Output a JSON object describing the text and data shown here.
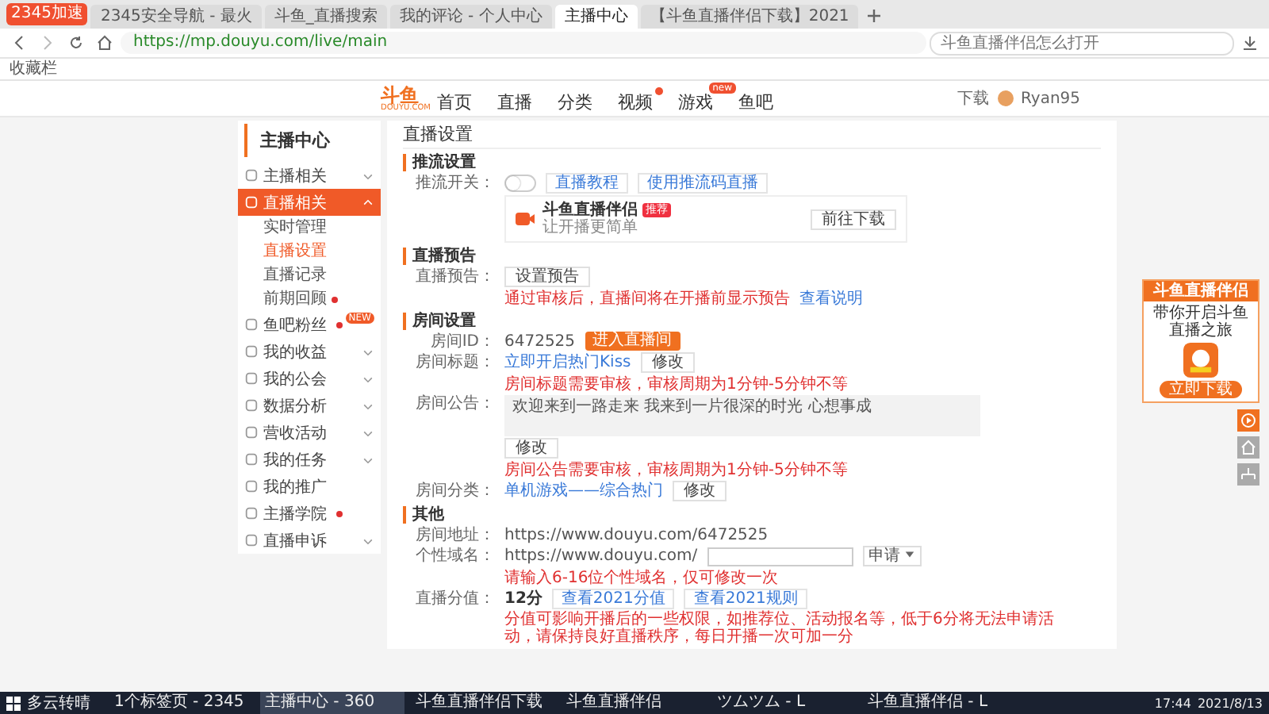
{
  "browser": {
    "badge": "2345加速",
    "tabs": [
      {
        "title": "2345安全导航 - 最火",
        "selected": false
      },
      {
        "title": "斗鱼_直播搜索",
        "selected": false
      },
      {
        "title": "我的评论 - 个人中心",
        "selected": false
      },
      {
        "title": "主播中心",
        "selected": true
      },
      {
        "title": "【斗鱼直播伴侣下载】2021",
        "selected": false
      }
    ],
    "url": "https://mp.douyu.com/live/main",
    "search": {
      "placeholder": "斗鱼直播伴侣怎么打开"
    },
    "bookmark": "收藏栏"
  },
  "site": {
    "logo": "斗鱼",
    "logo_sub": "DOUYU.COM",
    "nav": [
      {
        "label": "首页",
        "kind": "plain"
      },
      {
        "label": "直播",
        "kind": "plain"
      },
      {
        "label": "分类",
        "kind": "plain"
      },
      {
        "label": "视频",
        "kind": "dot"
      },
      {
        "label": "游戏",
        "kind": "new",
        "badge": "new"
      },
      {
        "label": "鱼吧",
        "kind": "plain"
      }
    ],
    "download": "下载",
    "user": "Ryan95"
  },
  "sidebar": {
    "title": "主播中心",
    "items": [
      {
        "label": "主播相关",
        "expanded": false,
        "selected": false
      },
      {
        "label": "直播相关",
        "expanded": true,
        "selected": true,
        "children": [
          {
            "label": "实时管理",
            "selected": false
          },
          {
            "label": "直播设置",
            "selected": true
          },
          {
            "label": "直播记录",
            "selected": false
          },
          {
            "label": "前期回顾",
            "selected": false,
            "dot": true
          }
        ]
      },
      {
        "label": "鱼吧粉丝",
        "selected": false,
        "dot": true,
        "badge": "NEW"
      },
      {
        "label": "我的收益",
        "expanded": false,
        "selected": false
      },
      {
        "label": "我的公会",
        "expanded": false,
        "selected": false
      },
      {
        "label": "数据分析",
        "expanded": false,
        "selected": false
      },
      {
        "label": "营收活动",
        "expanded": false,
        "selected": false
      },
      {
        "label": "我的任务",
        "expanded": false,
        "selected": false
      },
      {
        "label": "我的推广",
        "selected": false
      },
      {
        "label": "主播学院",
        "selected": false,
        "dot": true
      },
      {
        "label": "直播申诉",
        "expanded": false,
        "selected": false
      }
    ]
  },
  "page_title": "直播设置",
  "push": {
    "heading": "推流设置",
    "label": "推流开关：",
    "on": false,
    "buttons": [
      "直播教程",
      "使用推流码直播"
    ],
    "app": {
      "name": "斗鱼直播伴侣",
      "tag": "推荐",
      "desc": "让开播更简单",
      "button": "前往下载"
    }
  },
  "notice": {
    "heading": "直播预告",
    "label": "直播预告：",
    "button": "设置预告",
    "note": "通过审核后，直播间将在开播前显示预告",
    "link": "查看说明"
  },
  "room": {
    "heading": "房间设置",
    "id_label": "房间ID：",
    "id": "6472525",
    "id_button": "进入直播间",
    "title_label": "房间标题：",
    "title": "立即开启热门Kiss",
    "title_button": "修改",
    "title_note": "房间标题需要审核，审核周期为1分钟-5分钟不等",
    "bulletin_label": "房间公告：",
    "bulletin": "欢迎来到一路走来 我来到一片很深的时光 心想事成",
    "bulletin_button": "修改",
    "bulletin_note": "房间公告需要审核，审核周期为1分钟-5分钟不等",
    "category_label": "房间分类：",
    "category": "单机游戏——综合热门",
    "category_button": "修改"
  },
  "other": {
    "heading": "其他",
    "address_label": "房间地址：",
    "address": "https://www.douyu.com/6472525",
    "domain_label": "个性域名：",
    "domain_prefix": "https://www.douyu.com/",
    "domain_select": "申请",
    "domain_note": "请输入6-16位个性域名，仅可修改一次",
    "score_label": "直播分值：",
    "score": "12分",
    "score_links": [
      "查看2021分值",
      "查看2021规则"
    ],
    "score_note": "分值可影响开播后的一些权限，如推荐位、活动报名等，低于6分将无法申请活动，请保持良好直播秩序，每日开播一次可加一分"
  },
  "promo": {
    "title": "斗鱼直播伴侣",
    "desc": "带你开启斗鱼直播之旅",
    "button": "立即下载"
  },
  "taskbar": {
    "weather": "多云转晴",
    "apps": [
      {
        "label": "1个标签页 - 2345",
        "selected": false
      },
      {
        "label": "主播中心 - 360",
        "selected": true
      },
      {
        "label": "斗鱼直播伴侣下载",
        "selected": false
      },
      {
        "label": "斗鱼直播伴侣",
        "selected": false
      },
      {
        "label": "ツムツム - L",
        "selected": false
      },
      {
        "label": "斗鱼直播伴侣 - L",
        "selected": false
      }
    ],
    "time": "17:44",
    "date": "2021/8/13"
  }
}
